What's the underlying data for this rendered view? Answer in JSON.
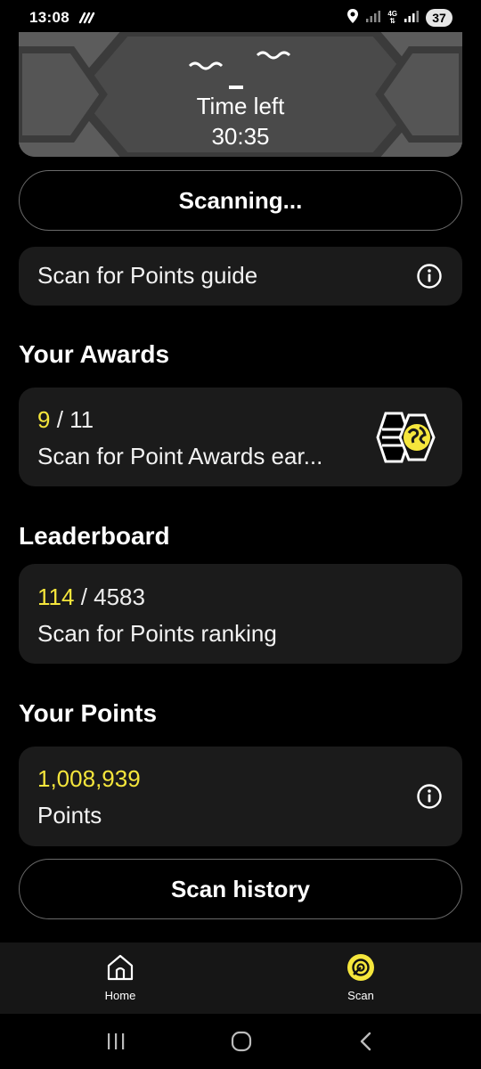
{
  "status_bar": {
    "time": "13:08",
    "network": "4G",
    "battery": "37"
  },
  "timer": {
    "label": "Time left",
    "value": "30:35"
  },
  "scan_button": {
    "label": "Scanning..."
  },
  "guide_card": {
    "label": "Scan for Points guide",
    "icon": "info-icon"
  },
  "awards": {
    "title": "Your Awards",
    "earned": "9",
    "total": "/ 11",
    "description": "Scan for Point Awards ear..."
  },
  "leaderboard": {
    "title": "Leaderboard",
    "rank": "114",
    "total": "/ 4583",
    "description": "Scan for Points ranking"
  },
  "points": {
    "title": "Your Points",
    "value": "1,008,939",
    "unit": "Points",
    "icon": "info-icon"
  },
  "history_button": {
    "label": "Scan history"
  },
  "bottom_nav": {
    "items": [
      {
        "label": "Home",
        "icon": "home-icon"
      },
      {
        "label": "Scan",
        "icon": "scan-icon"
      }
    ]
  },
  "colors": {
    "accent": "#f5e63c",
    "card_bg": "#1b1b1b",
    "background": "#000000"
  }
}
